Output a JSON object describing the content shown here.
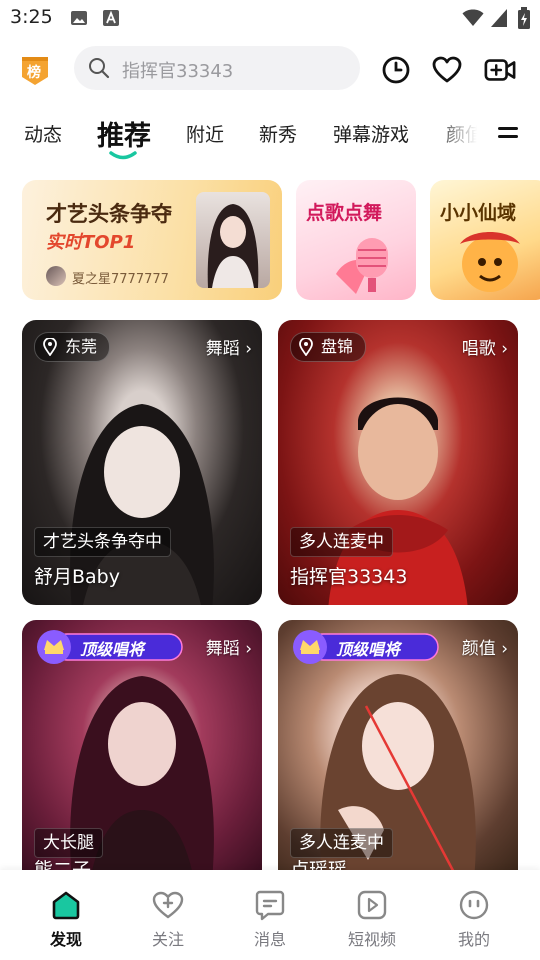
{
  "status_bar": {
    "time": "3:25"
  },
  "header": {
    "rank_badge": "榜",
    "search_placeholder": "指挥官33343"
  },
  "tabs": [
    "动态",
    "推荐",
    "附近",
    "新秀",
    "弹幕游戏",
    "颜值"
  ],
  "active_tab": "推荐",
  "banners": [
    {
      "title": "才艺头条争夺",
      "subtitle": "实时TOP1",
      "user": "夏之星7777777"
    },
    {
      "title": "点歌点舞"
    },
    {
      "title": "小小仙域"
    }
  ],
  "cards": [
    {
      "location": "东莞",
      "category": "舞蹈 ›",
      "status": "才艺头条争夺中",
      "name": "舒月Baby"
    },
    {
      "location": "盘锦",
      "category": "唱歌 ›",
      "status": "多人连麦中",
      "name": "指挥官33343"
    },
    {
      "badge": "顶级唱将",
      "category": "舞蹈 ›",
      "status": "大长腿",
      "name": "熊二子"
    },
    {
      "badge": "顶级唱将",
      "category": "颜值 ›",
      "status": "多人连麦中",
      "name": "卢瑶瑶"
    }
  ],
  "bottom_nav": [
    {
      "label": "发现",
      "icon": "home-icon"
    },
    {
      "label": "关注",
      "icon": "heart-plus-icon"
    },
    {
      "label": "消息",
      "icon": "message-icon"
    },
    {
      "label": "短视频",
      "icon": "video-play-icon"
    },
    {
      "label": "我的",
      "icon": "profile-face-icon"
    }
  ],
  "colors": {
    "accent": "#19c7a0",
    "badge_orange": "#f4a331"
  }
}
